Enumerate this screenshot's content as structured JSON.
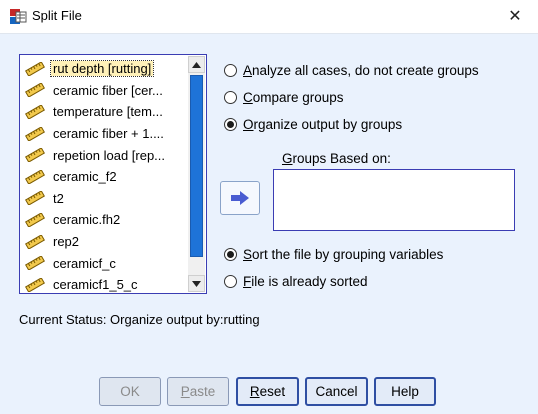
{
  "window": {
    "title": "Split File",
    "close_glyph": "✕"
  },
  "variables": [
    "rut depth [rutting]",
    "ceramic fiber [cer...",
    "temperature [tem...",
    "ceramic fiber + 1....",
    "repetion load [rep...",
    "ceramic_f2",
    "t2",
    "ceramic.fh2",
    "rep2",
    "ceramicf_c",
    "ceramicf1_5_c"
  ],
  "selected_variable_index": 0,
  "variable_icon": "ruler-scale-icon",
  "grouping_options": [
    {
      "pre": "",
      "key": "A",
      "post": "nalyze all cases, do not create groups",
      "checked": false
    },
    {
      "pre": "",
      "key": "C",
      "post": "ompare groups",
      "checked": false
    },
    {
      "pre": "",
      "key": "O",
      "post": "rganize output by groups",
      "checked": true
    }
  ],
  "groups_based_on": {
    "pre": "",
    "key": "G",
    "post": "roups Based on:"
  },
  "sort_options": [
    {
      "pre": "",
      "key": "S",
      "post": "ort the file by grouping variables",
      "checked": true
    },
    {
      "pre": "",
      "key": "F",
      "post": "ile is already sorted",
      "checked": false
    }
  ],
  "current_status": "Current Status: Organize output by:rutting",
  "buttons": {
    "ok": {
      "label": "OK",
      "enabled": false
    },
    "paste": {
      "pre": "",
      "key": "P",
      "post": "aste",
      "enabled": false
    },
    "reset": {
      "pre": "",
      "key": "R",
      "post": "eset",
      "enabled": true
    },
    "cancel": {
      "label": "Cancel",
      "enabled": true
    },
    "help": {
      "label": "Help",
      "enabled": true
    }
  },
  "colors": {
    "dialog_bg": "#eaf2fd",
    "list_border": "#3b3db3",
    "scroll_thumb": "#1e73d8",
    "arrow_button": "#4a5cd1",
    "selected_item_bg": "#fff1b8"
  }
}
